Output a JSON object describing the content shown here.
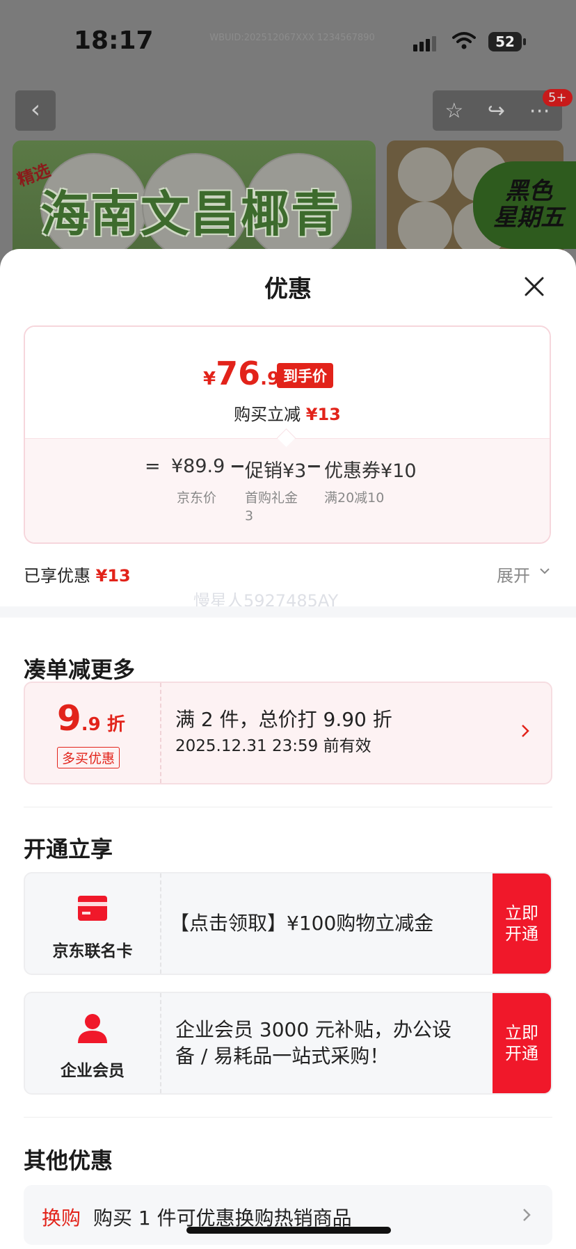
{
  "status": {
    "time": "18:17",
    "id_text": "WBUID:202512067XXX 1234567890",
    "battery": "52"
  },
  "header": {
    "notification_badge": "5+"
  },
  "banners": {
    "main_title": "海南文昌椰青",
    "main_tag": "精选",
    "side_badge_line1": "黑色",
    "side_badge_line2": "星期五"
  },
  "sheet": {
    "title": "优惠",
    "price": {
      "currency": "¥",
      "int": "76",
      "dec": ".9",
      "tag": "到手价",
      "reduce_label": "购买立减",
      "reduce_value": "¥13"
    },
    "formula": {
      "eq": "=",
      "jd_price": "¥89.9",
      "jd_price_label": "京东价",
      "minus": "−",
      "promo": "促销¥3",
      "promo_label_1": "首购礼金",
      "promo_label_2": "3",
      "coupon": "优惠券¥10",
      "coupon_label": "满20减10"
    },
    "enjoyed_label": "已享优惠",
    "enjoyed_value": "¥13",
    "expand_label": "展开",
    "watermark": "慢星人5927485AY"
  },
  "section_bundle": {
    "title": "凑单减更多",
    "discount_big": "9",
    "discount_small": ".9 折",
    "tag": "多买优惠",
    "line1": "满 2 件，总价打 9.90 折",
    "line2": "2025.12.31 23:59 前有效"
  },
  "section_open": {
    "title": "开通立享",
    "items": [
      {
        "label": "京东联名卡",
        "desc": "【点击领取】¥100购物立减金",
        "btn1": "立即",
        "btn2": "开通"
      },
      {
        "label": "企业会员",
        "desc1": "企业会员 3000 元补贴，办公设",
        "desc2": "备 / 易耗品一站式采购！",
        "btn1": "立即",
        "btn2": "开通"
      }
    ]
  },
  "section_other": {
    "title": "其他优惠",
    "tag": "换购",
    "text": "购买 1 件可优惠换购热销商品"
  },
  "colors": {
    "accent": "#e2231a",
    "button_red": "#f0182a"
  }
}
